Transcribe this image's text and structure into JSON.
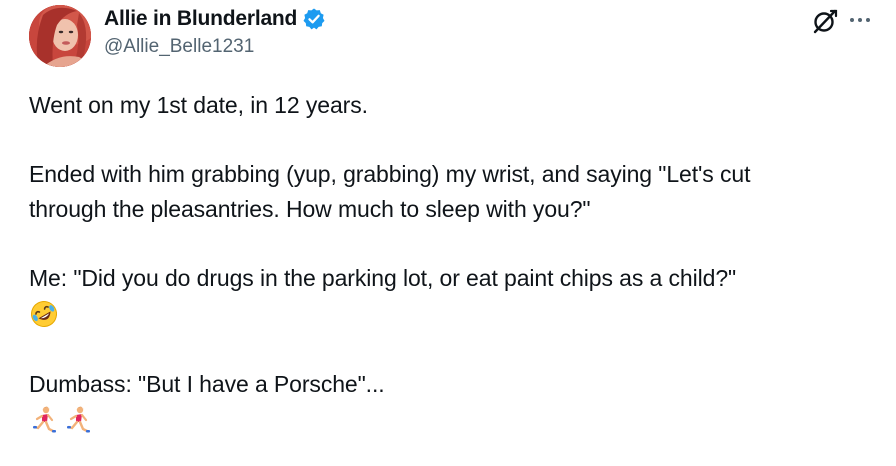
{
  "author": {
    "display_name": "Allie in Blunderland",
    "handle": "@Allie_Belle1231",
    "verified": true,
    "verified_color": "#1d9bf0"
  },
  "icons": {
    "grok": "grok-icon",
    "more": "more-options-icon",
    "verified": "verified-badge-icon"
  },
  "tweet": {
    "line1": "Went on my 1st date, in 12 years.",
    "line2": "Ended with him grabbing (yup, grabbing) my wrist, and saying \"Let's cut",
    "line3": "through the pleasantries. How much to sleep with you?\"",
    "line4": "Me: \"Did you do drugs in the parking lot, or eat paint chips as a child?\"",
    "emoji1": "rolling-on-floor-laughing-emoji",
    "line5": "Dumbass: \"But I have a Porsche\"...",
    "emoji2": [
      "woman-running-emoji",
      "woman-running-emoji"
    ]
  },
  "colors": {
    "text": "#0f1419",
    "secondary": "#536471",
    "accent": "#1d9bf0"
  }
}
